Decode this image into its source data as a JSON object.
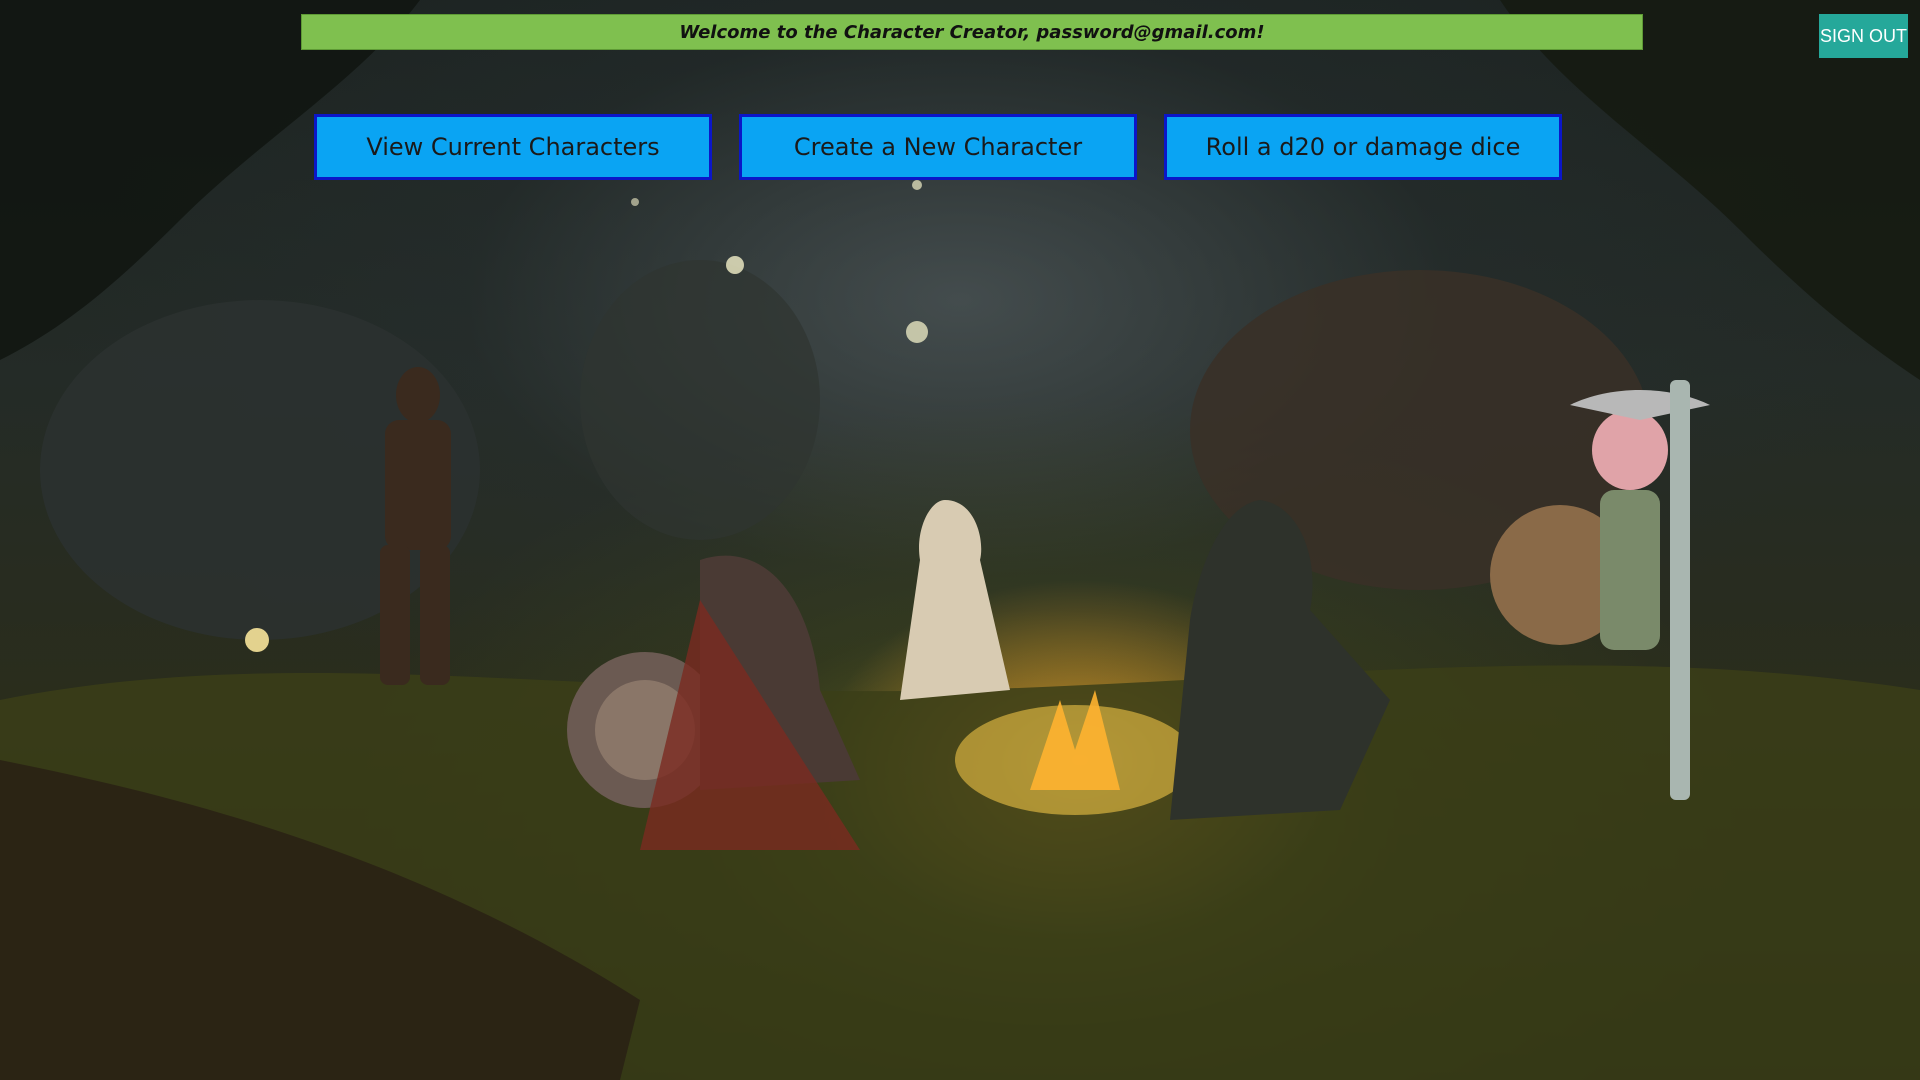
{
  "header": {
    "welcome_text": "Welcome to the Character Creator, password@gmail.com!",
    "sign_out_label": "SIGN OUT"
  },
  "nav": {
    "buttons": [
      {
        "label": "View Current Characters"
      },
      {
        "label": "Create a New Character"
      },
      {
        "label": "Roll a d20 or damage dice"
      }
    ]
  },
  "colors": {
    "welcome_bar": "#7fc04f",
    "sign_out": "#25a89a",
    "nav_button_bg": "#0aa4f3",
    "nav_button_border": "#0b16c8"
  }
}
